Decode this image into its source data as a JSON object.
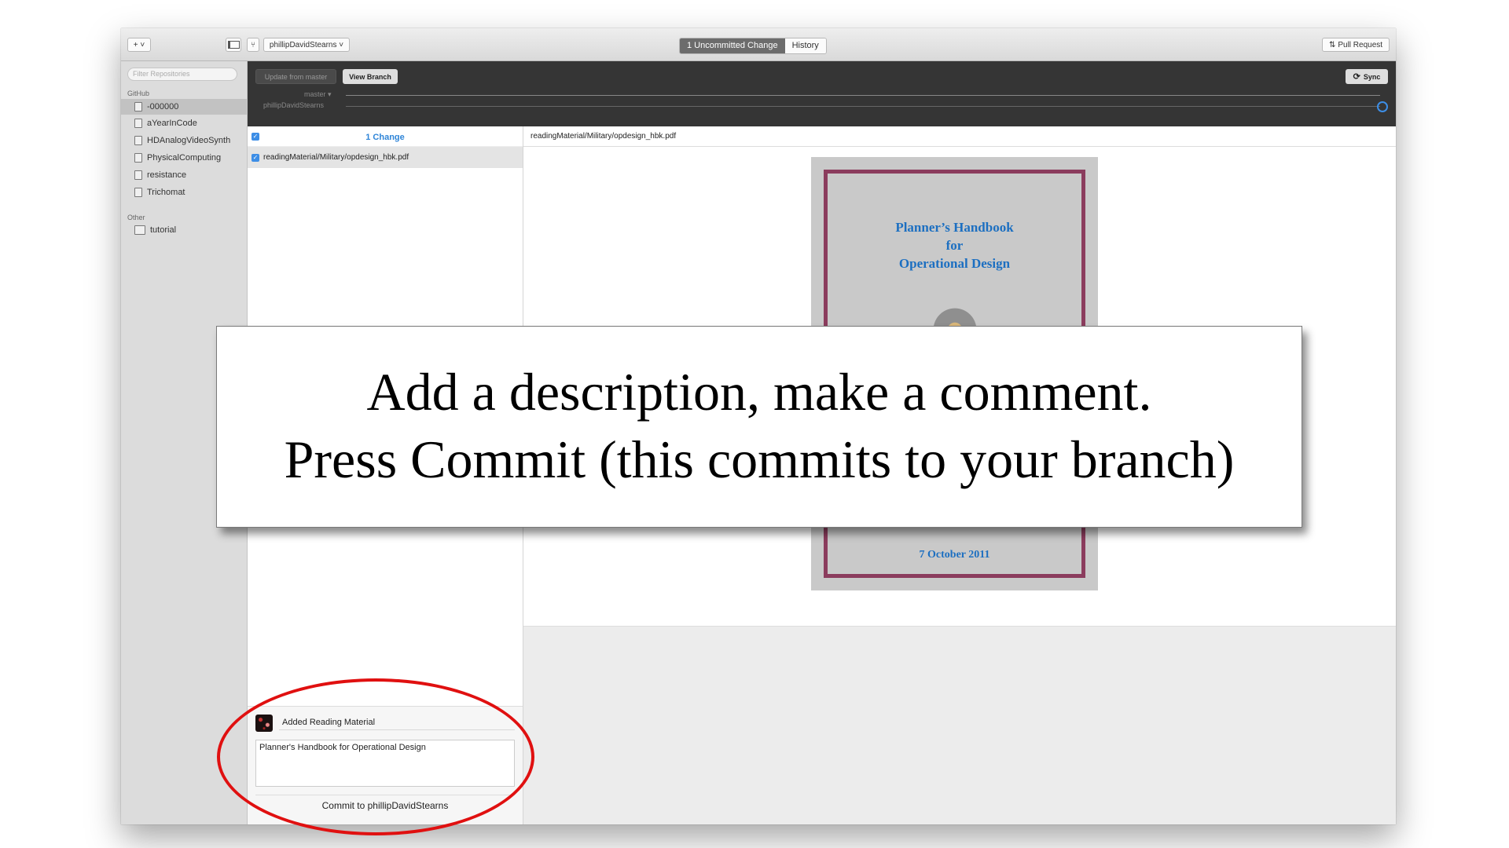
{
  "titlebar": {
    "add_button": "+ ˅",
    "branch_select": "phillipDavidStearns ˅",
    "tab_uncommitted": "1 Uncommitted Change",
    "tab_history": "History",
    "pull_request": "Pull Request"
  },
  "sidebar": {
    "filter_placeholder": "Filter Repositories",
    "github_header": "GitHub",
    "github_items": [
      "-000000",
      "aYearInCode",
      "HDAnalogVideoSynth",
      "PhysicalComputing",
      "resistance",
      "Trichomat"
    ],
    "other_header": "Other",
    "other_items": [
      "tutorial"
    ]
  },
  "branchbar": {
    "update_button": "Update from master",
    "view_branch_button": "View Branch",
    "sync_button": "Sync",
    "master_label": "master ▾",
    "branch_label": "phillipDavidStearns"
  },
  "changes": {
    "count_label": "1 Change",
    "file": "readingMaterial/Military/opdesign_hbk.pdf"
  },
  "commit": {
    "summary": "Added Reading Material",
    "description": "Planner's Handbook for Operational Design",
    "button": "Commit to phillipDavidStearns"
  },
  "diff": {
    "path": "readingMaterial/Military/opdesign_hbk.pdf",
    "pdf_title_1": "Planner’s Handbook",
    "pdf_title_2": "for",
    "pdf_title_3": "Operational Design",
    "pdf_date": "7 October 2011"
  },
  "overlay": {
    "line1": "Add a description, make a comment.",
    "line2": "Press Commit (this commits to your branch)"
  },
  "colors": {
    "accent_blue": "#2f85d8",
    "dark_bar": "#353535",
    "annotation_red": "#e01010",
    "pdf_frame": "#8b3c5d"
  }
}
